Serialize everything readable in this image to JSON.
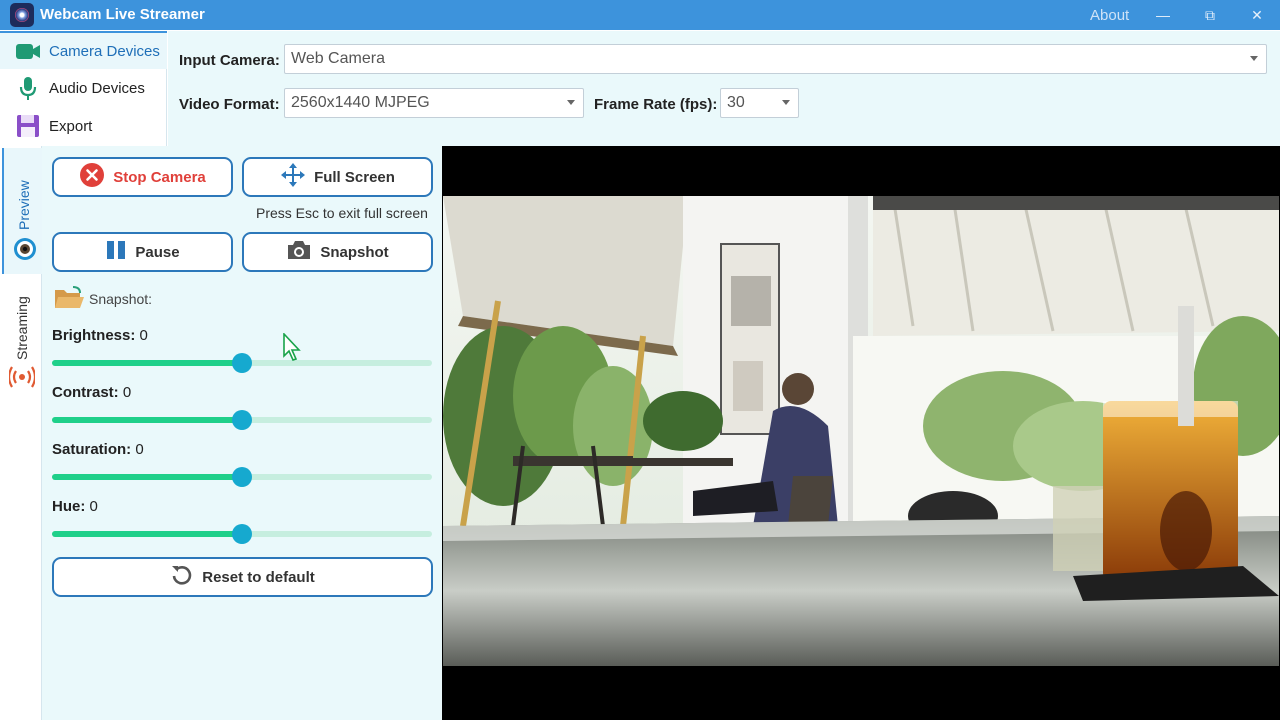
{
  "window": {
    "title": "Webcam Live Streamer",
    "about": "About",
    "controls": {
      "minimize": "—",
      "maximize": "⧉",
      "close": "✕"
    }
  },
  "top_tabs": [
    {
      "label": "Camera Devices",
      "icon": "video-camera-icon",
      "selected": true
    },
    {
      "label": "Audio Devices",
      "icon": "microphone-icon",
      "selected": false
    },
    {
      "label": "Export",
      "icon": "save-icon",
      "selected": false
    }
  ],
  "settings": {
    "input_camera_label": "Input Camera:",
    "input_camera_value": "Web Camera",
    "video_format_label": "Video Format:",
    "video_format_value": "2560x1440 MJPEG",
    "frame_rate_label": "Frame Rate (fps):",
    "frame_rate_value": "30"
  },
  "side_tabs": [
    {
      "label": "Preview",
      "icon": "eye-icon",
      "selected": true
    },
    {
      "label": "Streaming",
      "icon": "broadcast-icon",
      "selected": false
    }
  ],
  "controls": {
    "stop_camera": "Stop Camera",
    "full_screen": "Full Screen",
    "full_screen_hint": "Press Esc to exit full screen",
    "pause": "Pause",
    "snapshot": "Snapshot",
    "snapshot_folder_label": "Snapshot:",
    "reset": "Reset to default"
  },
  "sliders": [
    {
      "name": "Brightness:",
      "value": "0",
      "fraction": 0.5
    },
    {
      "name": "Contrast:",
      "value": "0",
      "fraction": 0.5
    },
    {
      "name": "Saturation:",
      "value": "0",
      "fraction": 0.5
    },
    {
      "name": "Hue:",
      "value": "0",
      "fraction": 0.5
    }
  ],
  "colors": {
    "titlebar": "#3d93dc",
    "panel_bg": "#eaf9fb",
    "button_border": "#2c78ba",
    "slider_fill": "#1fd08a",
    "slider_thumb": "#16a9cf",
    "stop_red": "#e0403a",
    "accent_text": "#1f6fb8"
  }
}
